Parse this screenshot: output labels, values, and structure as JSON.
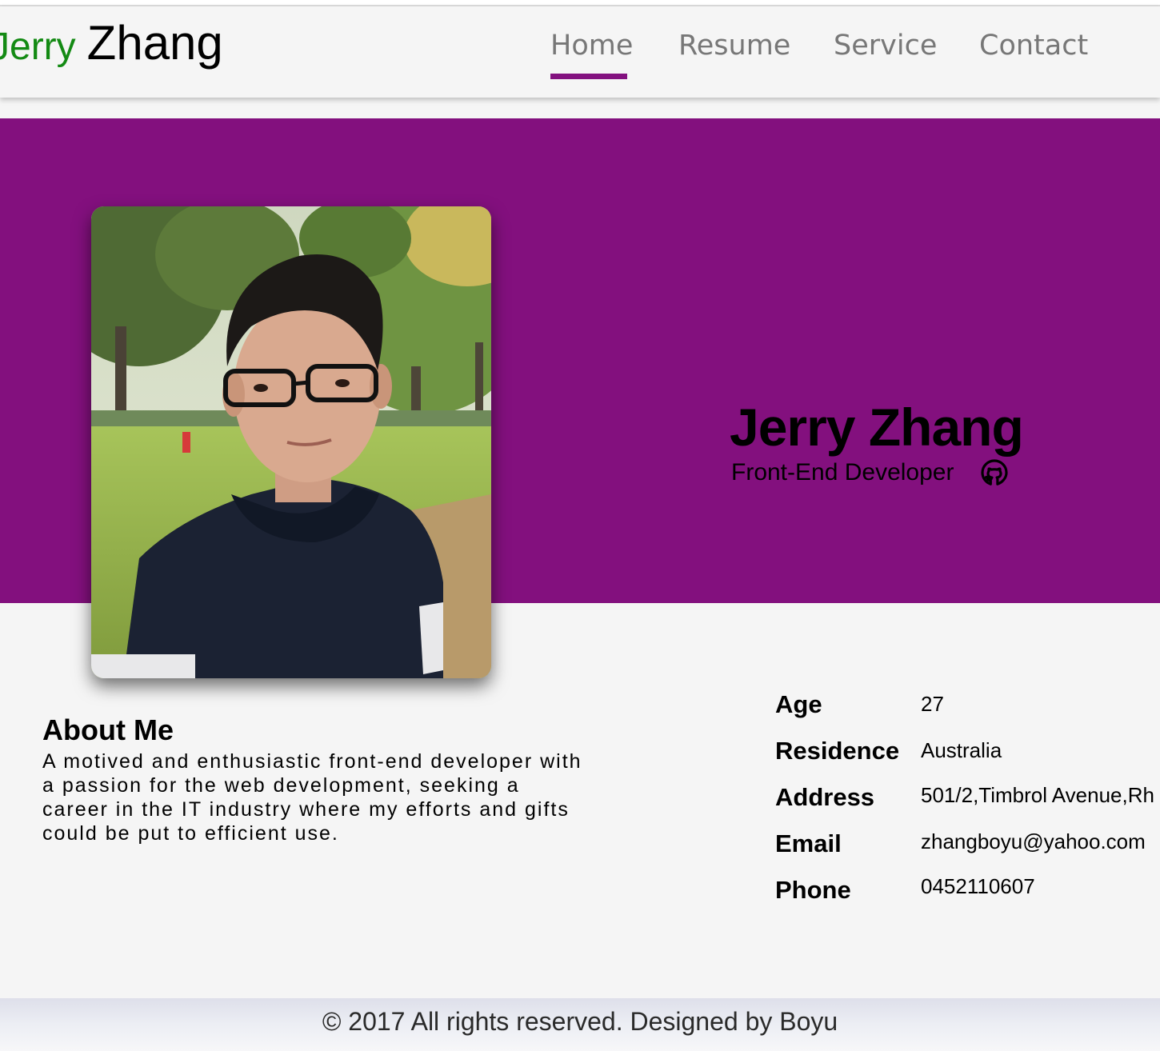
{
  "brand": {
    "first": "Jerry",
    "last": "Zhang",
    "first_color": "#138a13"
  },
  "nav": {
    "items": [
      {
        "label": "Home",
        "active": true
      },
      {
        "label": "Resume",
        "active": false
      },
      {
        "label": "Service",
        "active": false
      },
      {
        "label": "Contact",
        "active": false
      }
    ],
    "accent_color": "#83117f"
  },
  "hero": {
    "name": "Jerry Zhang",
    "title": "Front-End Developer",
    "background_color": "#83107e",
    "photo_icon": "profile-photo",
    "social_icon": "github-icon"
  },
  "about": {
    "heading": "About Me",
    "text": "A motived and enthusiastic front-end developer with a passion for the web development, seeking a career in the IT industry where my efforts and gifts could be put to efficient use."
  },
  "info": [
    {
      "label": "Age",
      "value": "27"
    },
    {
      "label": "Residence",
      "value": "Australia"
    },
    {
      "label": "Address",
      "value": "501/2,Timbrol Avenue,Rh"
    },
    {
      "label": "Email",
      "value": "zhangboyu@yahoo.com"
    },
    {
      "label": "Phone",
      "value": "0452110607"
    }
  ],
  "footer": {
    "text": "© 2017 All rights reserved. Designed by Boyu"
  }
}
